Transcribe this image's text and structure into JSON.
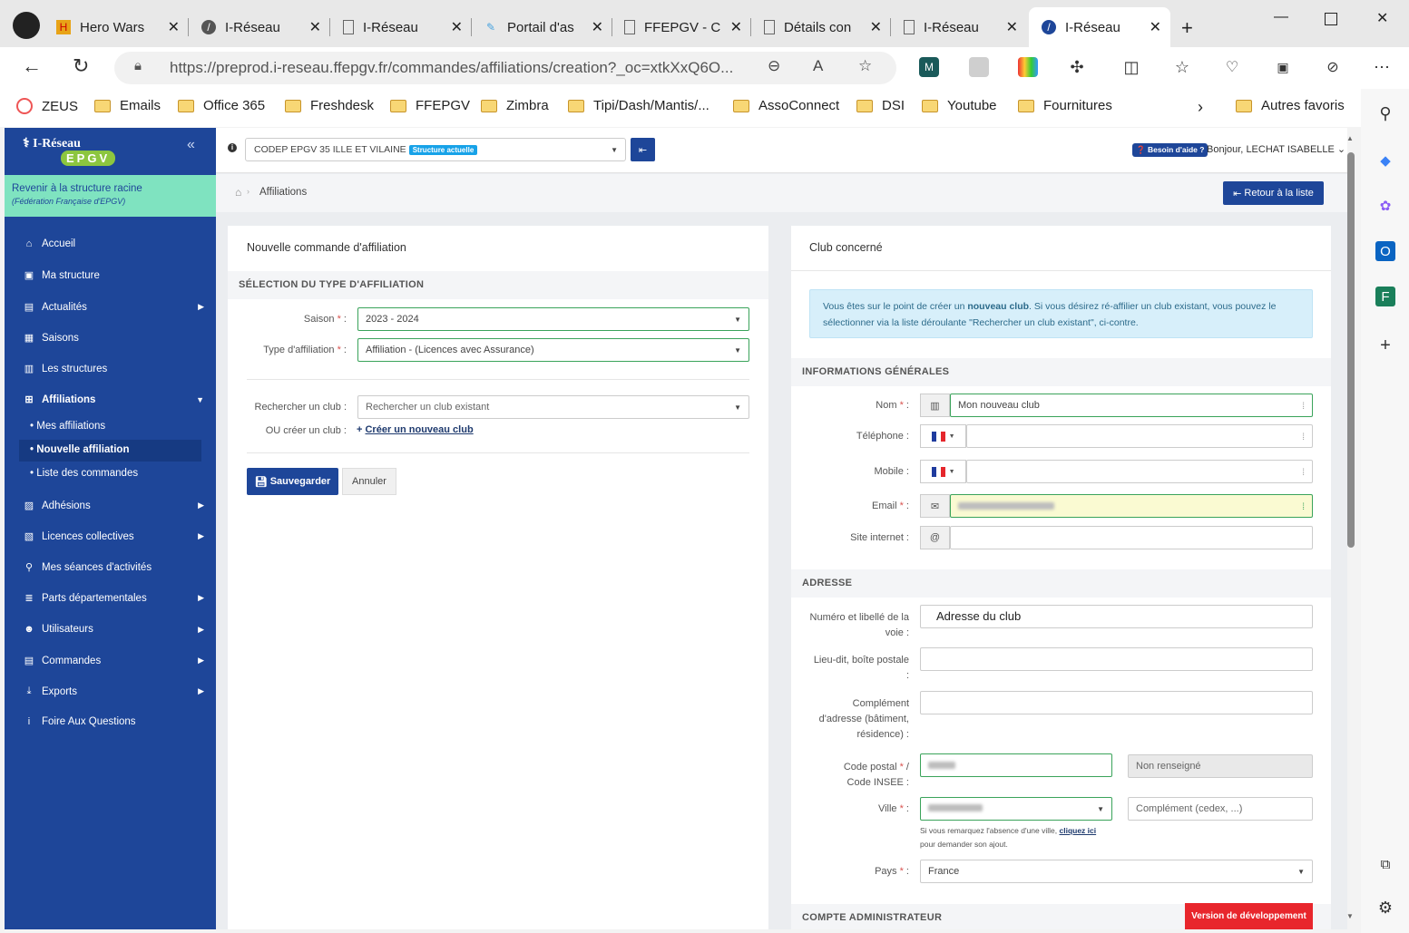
{
  "browser": {
    "tabs": [
      {
        "title": "Hero Wars",
        "icon": "game-icon"
      },
      {
        "title": "I-Réseau",
        "icon": "ireseau-icon"
      },
      {
        "title": "I-Réseau",
        "icon": "page-icon"
      },
      {
        "title": "Portail d'as",
        "icon": "portal-icon"
      },
      {
        "title": "FFEPGV - C",
        "icon": "page-icon"
      },
      {
        "title": "Détails con",
        "icon": "page-icon"
      },
      {
        "title": "I-Réseau",
        "icon": "page-icon"
      },
      {
        "title": "I-Réseau",
        "icon": "ireseau-icon",
        "active": true
      }
    ],
    "url": "https://preprod.i-reseau.ffepgv.fr/commandes/affiliations/creation?_oc=xtkXxQ6O...",
    "bookmarks": [
      "ZEUS",
      "Emails",
      "Office 365",
      "Freshdesk",
      "FFEPGV",
      "Zimbra",
      "Tipi/Dash/Mantis/...",
      "AssoConnect",
      "DSI",
      "Youtube",
      "Fournitures"
    ],
    "other_bookmarks": "Autres favoris"
  },
  "sidebar": {
    "logo_title": "I-Réseau",
    "logo_sub": "EPGV",
    "root_link": "Revenir à la structure racine",
    "root_sub": "(Fédération Française d'EPGV)",
    "items": [
      {
        "label": "Accueil",
        "icon": "home-icon",
        "glyph": "⌂"
      },
      {
        "label": "Ma structure",
        "icon": "briefcase-icon",
        "glyph": "▣"
      },
      {
        "label": "Actualités",
        "icon": "newspaper-icon",
        "glyph": "▤",
        "arrow": true
      },
      {
        "label": "Saisons",
        "icon": "calendar-icon",
        "glyph": "▦"
      },
      {
        "label": "Les structures",
        "icon": "building-icon",
        "glyph": "▥"
      },
      {
        "label": "Affiliations",
        "icon": "sitemap-icon",
        "glyph": "⊞",
        "open": true
      },
      {
        "label": "Adhésions",
        "icon": "id-card-icon",
        "glyph": "▨",
        "arrow": true
      },
      {
        "label": "Licences collectives",
        "icon": "file-icon",
        "glyph": "▧",
        "arrow": true
      },
      {
        "label": "Mes séances d'activités",
        "icon": "running-icon",
        "glyph": "⚲"
      },
      {
        "label": "Parts départementales",
        "icon": "database-icon",
        "glyph": "≣",
        "arrow": true
      },
      {
        "label": "Utilisateurs",
        "icon": "users-icon",
        "glyph": "☻",
        "arrow": true
      },
      {
        "label": "Commandes",
        "icon": "list-icon",
        "glyph": "▤",
        "arrow": true
      },
      {
        "label": "Exports",
        "icon": "download-icon",
        "glyph": "⤓",
        "arrow": true
      },
      {
        "label": "Foire Aux Questions",
        "icon": "info-icon",
        "glyph": "i"
      }
    ],
    "subitems": [
      "Mes affiliations",
      "Nouvelle affiliation",
      "Liste des commandes"
    ]
  },
  "header": {
    "structure": "CODEP EPGV 35 ILLE ET VILAINE",
    "structure_badge": "Structure actuelle",
    "help": "Besoin d'aide ?",
    "greeting": "Bonjour,",
    "user": "LECHAT ISABELLE"
  },
  "breadcrumb": {
    "label": "Affiliations",
    "back_button": "Retour à la liste"
  },
  "order": {
    "title": "Nouvelle commande d'affiliation",
    "section": "SÉLECTION DU TYPE D'AFFILIATION",
    "saison_label": "Saison",
    "saison_value": "2023 - 2024",
    "type_label": "Type d'affiliation",
    "type_value": "Affiliation - (Licences avec Assurance)",
    "search_label": "Rechercher un club :",
    "search_placeholder": "Rechercher un club existant",
    "or_label": "OU créer un club :",
    "create_link": "Créer un nouveau club",
    "save_button": "Sauvegarder",
    "cancel_button": "Annuler"
  },
  "club": {
    "title": "Club concerné",
    "info_prefix": "Vous êtes sur le point de créer un ",
    "info_bold": "nouveau club",
    "info_rest": ". Si vous désirez ré-affilier un club existant, vous pouvez le",
    "info_line2": "sélectionner via la liste déroulante \"Rechercher un club existant\", ci-contre.",
    "general_section": "INFORMATIONS GÉNÉRALES",
    "nom_label": "Nom",
    "nom_value": "Mon nouveau club",
    "tel_label": "Téléphone :",
    "mobile_label": "Mobile :",
    "email_label": "Email",
    "site_label": "Site internet :",
    "address_section": "ADRESSE",
    "street_label_1": "Numéro et libellé de la",
    "street_label_2": "voie :",
    "street_value": "Adresse du club",
    "lieu_label_1": "Lieu-dit, boîte postale",
    "lieu_label_2": ":",
    "comp_label_1": "Complément",
    "comp_label_2": "d'adresse (bâtiment,",
    "comp_label_3": "résidence) :",
    "cp_label_1": "Code postal",
    "cp_label_2": "Code INSEE :",
    "insee_value": "Non renseigné",
    "ville_label": "Ville",
    "ville_comp_placeholder": "Complément (cedex, ...)",
    "ville_help_1": "Si vous remarquez l'absence d'une ville, ",
    "ville_help_link": "cliquez ici",
    "ville_help_2": "pour demander son ajout.",
    "pays_label": "Pays",
    "pays_value": "France",
    "admin_section": "COMPTE ADMINISTRATEUR",
    "dev_badge": "Version de développement"
  },
  "colors": {
    "primary": "#1e4699",
    "root_bg": "#7fe3c0",
    "valid": "#3aa35a",
    "dev": "#e8262c"
  }
}
